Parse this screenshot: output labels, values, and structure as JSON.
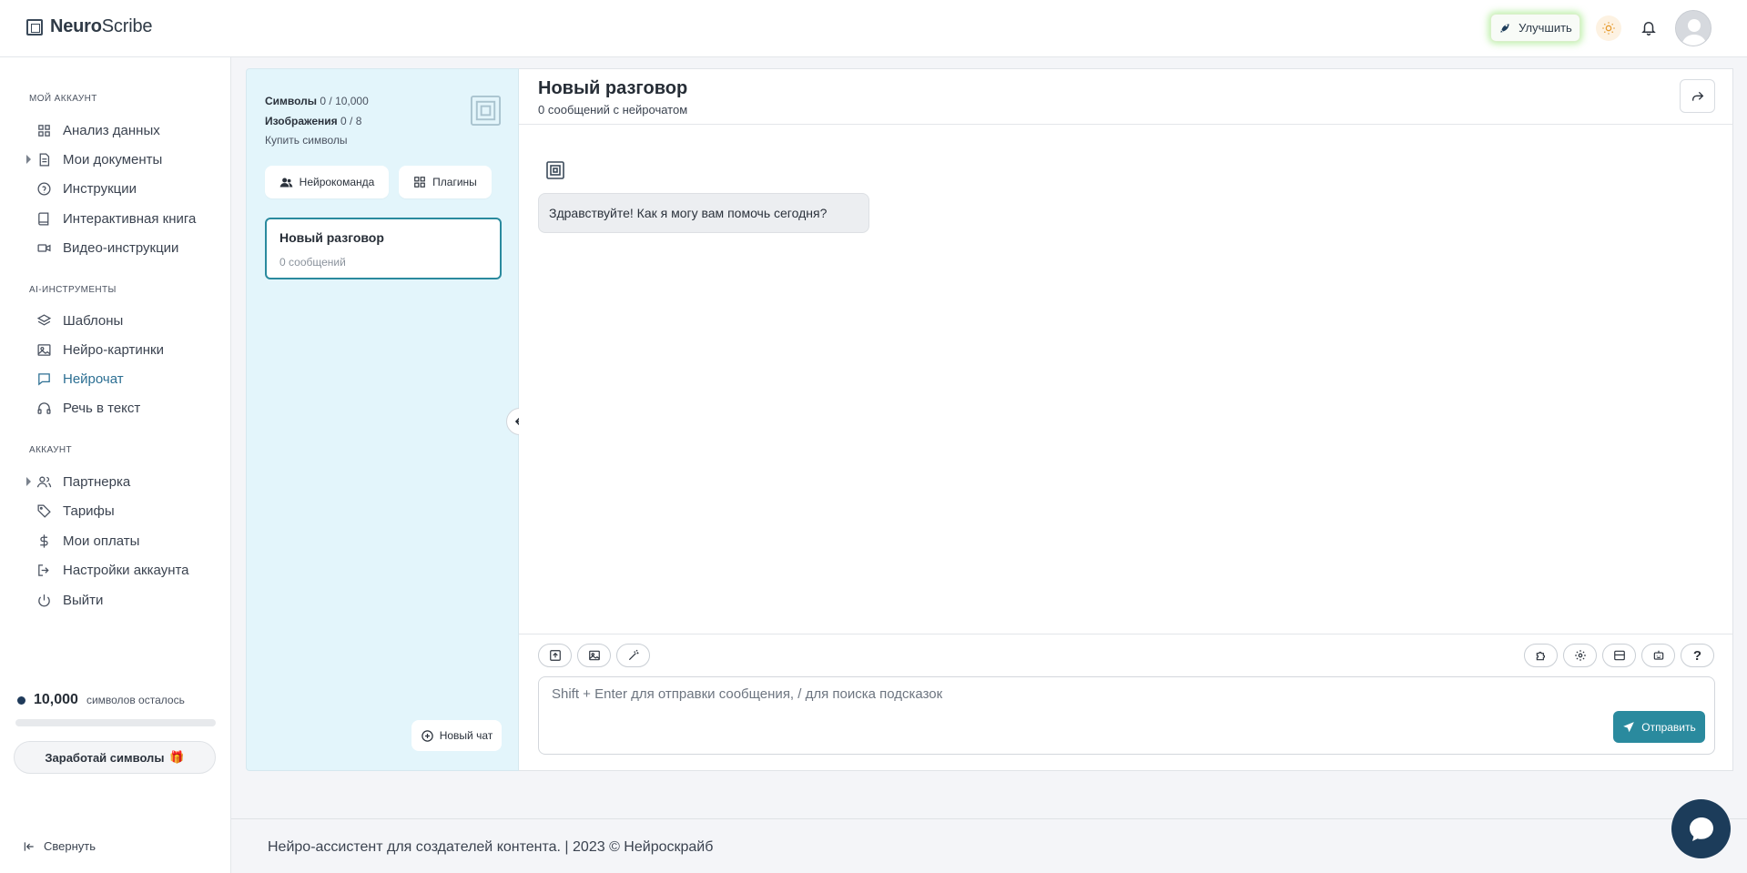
{
  "header": {
    "logo_bold": "Neuro",
    "logo_light": "Scribe",
    "upgrade_label": "Улучшить"
  },
  "sidebar": {
    "section_account": "МОЙ АККАУНТ",
    "items_account": [
      {
        "label": "Анализ данных",
        "icon": "grid-icon"
      },
      {
        "label": "Мои документы",
        "icon": "document-icon"
      },
      {
        "label": "Инструкции",
        "icon": "help-circle-icon"
      },
      {
        "label": "Интерактивная книга",
        "icon": "book-icon"
      },
      {
        "label": "Видео-инструкции",
        "icon": "video-icon"
      }
    ],
    "section_ai": "AI-ИНСТРУМЕНТЫ",
    "items_ai": [
      {
        "label": "Шаблоны",
        "icon": "layers-icon"
      },
      {
        "label": "Нейро-картинки",
        "icon": "image-icon"
      },
      {
        "label": "Нейрочат",
        "icon": "chat-icon",
        "active": true
      },
      {
        "label": "Речь в текст",
        "icon": "headphones-icon"
      }
    ],
    "section_acc2": "АККАУНТ",
    "items_acc2": [
      {
        "label": "Партнерка",
        "icon": "users-icon"
      },
      {
        "label": "Тарифы",
        "icon": "tag-icon"
      },
      {
        "label": "Мои оплаты",
        "icon": "dollar-icon"
      },
      {
        "label": "Настройки аккаунта",
        "icon": "logout-arrow-icon"
      },
      {
        "label": "Выйти",
        "icon": "power-icon"
      }
    ],
    "credits_value": "10,000",
    "credits_label": "символов осталось",
    "earn_label": "Заработай символы",
    "earn_emoji": "🎁",
    "collapse_label": "Свернуть"
  },
  "panel": {
    "symbols_label": "Символы",
    "symbols_value": "0 / 10,000",
    "images_label": "Изображения",
    "images_value": "0 / 8",
    "buy_label": "Купить символы",
    "team_label": "Нейрокоманда",
    "plugins_label": "Плагины",
    "conversation": {
      "title": "Новый разговор",
      "subtitle": "0 сообщений"
    },
    "new_chat_label": "Новый чат"
  },
  "chat": {
    "title": "Новый разговор",
    "subtitle": "0 сообщений с нейрочатом",
    "greeting": "Здравствуйте! Как я могу вам помочь сегодня?",
    "placeholder": "Shift + Enter для отправки сообщения, / для поиска подсказок",
    "send_label": "Отправить",
    "help_glyph": "?"
  },
  "footer": {
    "text": "Нейро-ассистент для создателей контента.  | 2023 © Нейроскрайб"
  },
  "colors": {
    "accent": "#2a8a9e",
    "panel_bg": "#e3f5fb",
    "active_nav": "#2c6f93",
    "fab": "#1c3c5a"
  }
}
